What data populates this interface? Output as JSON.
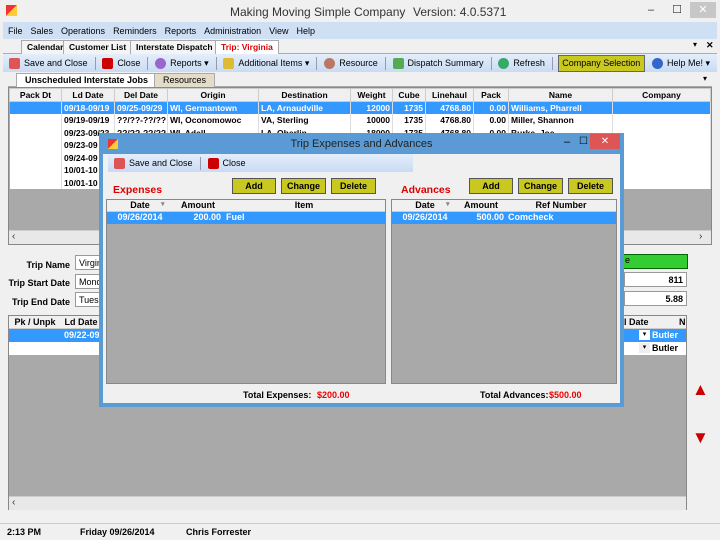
{
  "window": {
    "title": "Making Moving Simple Company",
    "version": "Version: 4.0.5371",
    "minimize": "–",
    "maximize": "☐",
    "close": "✕"
  },
  "menu": [
    "File",
    "Sales",
    "Operations",
    "Reminders",
    "Reports",
    "Administration",
    "View",
    "Help"
  ],
  "doc_tabs": [
    {
      "label": "Calendar",
      "active": false
    },
    {
      "label": "Customer List",
      "active": false
    },
    {
      "label": "Interstate Dispatch",
      "active": false
    },
    {
      "label": "Trip: Virginia",
      "active": true
    }
  ],
  "doc_tab_controls": {
    "dropdown": "▾",
    "close": "✕"
  },
  "toolbar": {
    "save_close": "Save and Close",
    "close": "Close",
    "reports": "Reports ▾",
    "additional_items": "Additional Items ▾",
    "resource": "Resource",
    "dispatch_summary": "Dispatch Summary",
    "refresh": "Refresh",
    "company_selection": "Company Selection",
    "help": "Help Me! ▾"
  },
  "sub_tabs": [
    {
      "label": "Unscheduled Interstate Jobs",
      "active": true
    },
    {
      "label": "Resources",
      "active": false
    }
  ],
  "jobs_grid": {
    "columns": [
      "Pack Dt",
      "Ld Date",
      "Del Date",
      "Origin",
      "Destination",
      "Weight",
      "Cube",
      "Linehaul",
      "Pack",
      "Name",
      "Company"
    ],
    "rows": [
      [
        "",
        "09/18-09/19",
        "09/25-09/29",
        "WI, Germantown",
        "LA, Arnaudville",
        "12000",
        "1735",
        "4768.80",
        "0.00",
        "Williams, Pharrell",
        ""
      ],
      [
        "",
        "09/19-09/19",
        "??/??-??/??",
        "WI, Oconomowoc",
        "VA, Sterling",
        "10000",
        "1735",
        "4768.80",
        "0.00",
        "Miller, Shannon",
        ""
      ],
      [
        "",
        "09/23-09/23",
        "??/??-??/??",
        "WI, Adell",
        "LA, Oberlin",
        "18000",
        "1735",
        "4768.80",
        "0.00",
        "Burke, Joe",
        ""
      ],
      [
        "",
        "09/23-09",
        "",
        "",
        "",
        "",
        "",
        "",
        "",
        "",
        ""
      ],
      [
        "",
        "09/24-09",
        "",
        "",
        "",
        "",
        "",
        "",
        "",
        "",
        ""
      ],
      [
        "",
        "10/01-10",
        "",
        "",
        "",
        "",
        "",
        "",
        "",
        "",
        ""
      ],
      [
        "",
        "10/01-10",
        "",
        "",
        "",
        "",
        "",
        "",
        "",
        "",
        ""
      ]
    ],
    "selected_row": 0,
    "scroll_left": "‹",
    "scroll_right": "›"
  },
  "trip_form": {
    "trip_name_label": "Trip Name",
    "trip_name_value": "Virginia",
    "start_label": "Trip Start Date",
    "start_value": "Monday",
    "end_label": "Trip End Date",
    "end_value": "Tuesday",
    "right_field_1": "811",
    "right_field_2": "5.88",
    "green_button": "e"
  },
  "trip_grid": {
    "columns": [
      "Pk / Unpk",
      "Ld Date"
    ],
    "rows": [
      [
        "",
        "09/22-09"
      ],
      [
        "",
        ""
      ]
    ],
    "right_columns": [
      "al Date",
      "N"
    ],
    "right_rows": [
      [
        "Butler"
      ],
      [
        "Butler"
      ]
    ]
  },
  "move_up": "▲",
  "move_down": "▼",
  "dialog": {
    "title": "Trip Expenses and Advances",
    "save_close": "Save and Close",
    "close": "Close",
    "expenses": {
      "title": "Expenses",
      "add": "Add",
      "change": "Change",
      "delete": "Delete",
      "columns": [
        "Date",
        "Amount",
        "Item"
      ],
      "rows": [
        [
          "09/26/2014",
          "200.00",
          "Fuel"
        ]
      ],
      "total_label": "Total Expenses:",
      "total_value": "$200.00"
    },
    "advances": {
      "title": "Advances",
      "add": "Add",
      "change": "Change",
      "delete": "Delete",
      "columns": [
        "Date",
        "Amount",
        "Ref Number"
      ],
      "rows": [
        [
          "09/26/2014",
          "500.00",
          "Comcheck"
        ]
      ],
      "total_label": "Total Advances:",
      "total_value": "$500.00"
    }
  },
  "status": {
    "time": "2:13 PM",
    "date": "Friday 09/26/2014",
    "user": "Chris Forrester"
  }
}
